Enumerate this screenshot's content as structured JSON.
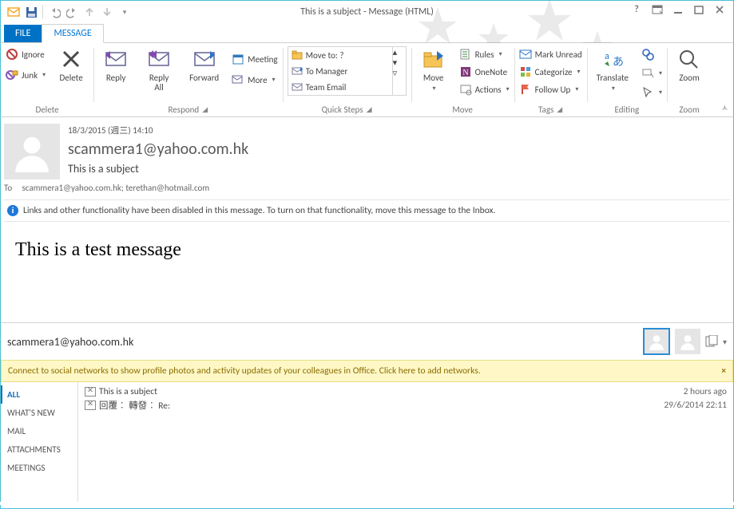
{
  "title": "This is a subject - Message (HTML)",
  "tabs": {
    "file": "FILE",
    "message": "MESSAGE"
  },
  "ribbon": {
    "delete_group": {
      "ignore": "Ignore",
      "junk": "Junk",
      "delete": "Delete",
      "label": "Delete"
    },
    "respond_group": {
      "reply": "Reply",
      "reply_all": "Reply\nAll",
      "forward": "Forward",
      "meeting": "Meeting",
      "more": "More",
      "label": "Respond"
    },
    "quicksteps_group": {
      "items": [
        "Move to: ?",
        "To Manager",
        "Team Email"
      ],
      "label": "Quick Steps"
    },
    "move_group": {
      "move": "Move",
      "rules": "Rules",
      "onenote": "OneNote",
      "actions": "Actions",
      "label": "Move"
    },
    "tags_group": {
      "mark_unread": "Mark Unread",
      "categorize": "Categorize",
      "follow_up": "Follow Up",
      "label": "Tags"
    },
    "editing_group": {
      "translate": "Translate",
      "label": "Editing"
    },
    "zoom_group": {
      "zoom": "Zoom",
      "label": "Zoom"
    }
  },
  "header": {
    "date": "18/3/2015 (週三) 14:10",
    "from": "scammera1@yahoo.com.hk",
    "subject": "This is a subject",
    "to_label": "To",
    "to": "scammera1@yahoo.com.hk; terethan@hotmail.com"
  },
  "infobar": "Links and other functionality have been disabled in this message. To turn on that functionality, move this message to the Inbox.",
  "body": "This is a test message",
  "people": {
    "name": "scammera1@yahoo.com.hk",
    "banner": "Connect to social networks to show profile photos and activity updates of your colleagues in Office. Click here to add networks.",
    "nav": [
      "ALL",
      "WHAT'S NEW",
      "MAIL",
      "ATTACHMENTS",
      "MEETINGS"
    ],
    "items": [
      {
        "subject": "This is a subject",
        "when": "2 hours ago"
      },
      {
        "subject": "回覆︰ 轉發︰ Re:",
        "when": "29/6/2014 22:11"
      }
    ]
  }
}
